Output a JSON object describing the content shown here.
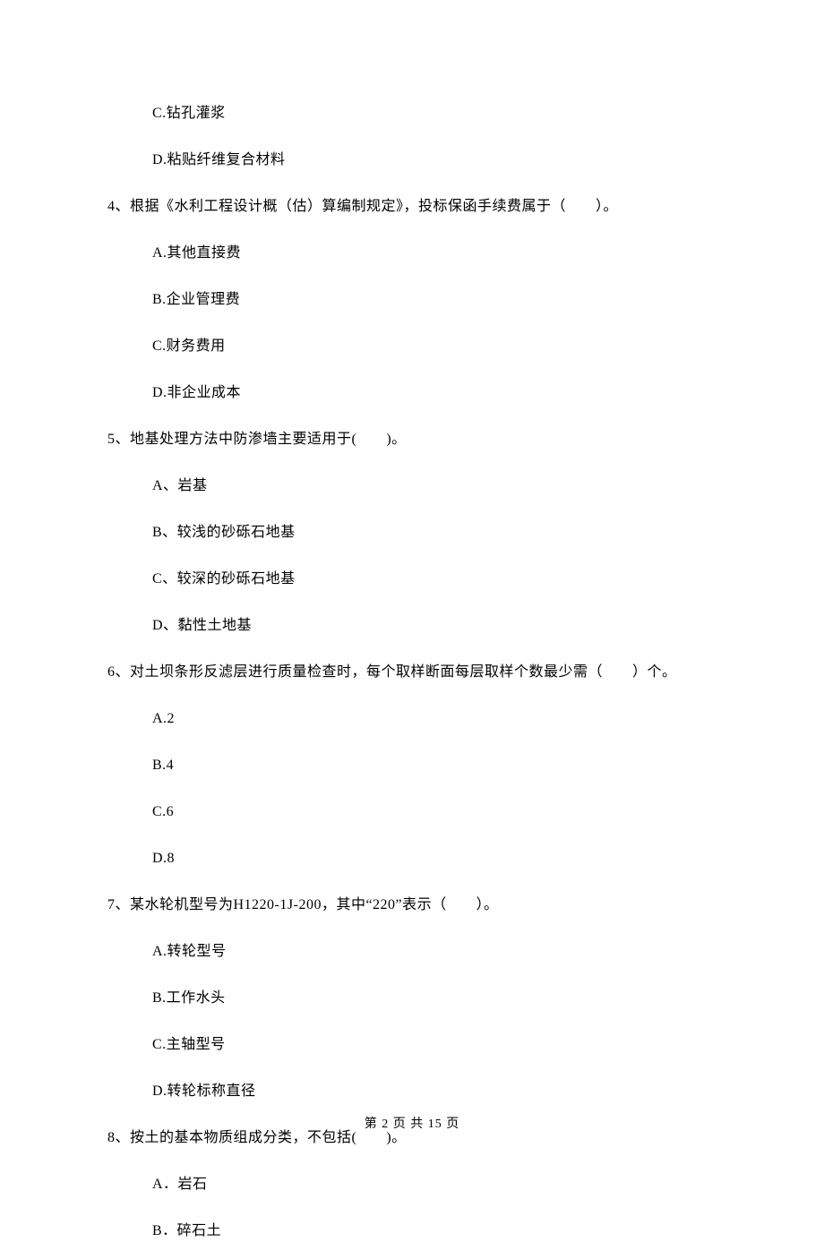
{
  "options_pre": [
    "C.钻孔灌浆",
    "D.粘贴纤维复合材料"
  ],
  "questions": [
    {
      "stem": "4、根据《水利工程设计概（估）算编制规定》，投标保函手续费属于（　　）。",
      "options": [
        "A.其他直接费",
        "B.企业管理费",
        "C.财务费用",
        "D.非企业成本"
      ]
    },
    {
      "stem": "5、地基处理方法中防渗墙主要适用于(　　)。",
      "options": [
        "A、岩基",
        "B、较浅的砂砾石地基",
        "C、较深的砂砾石地基",
        "D、黏性土地基"
      ]
    },
    {
      "stem": "6、对土坝条形反滤层进行质量检查时，每个取样断面每层取样个数最少需（　　）个。",
      "options": [
        "A.2",
        "B.4",
        "C.6",
        "D.8"
      ]
    },
    {
      "stem": "7、某水轮机型号为H1220-1J-200，其中“220”表示（　　）。",
      "options": [
        "A.转轮型号",
        "B.工作水头",
        "C.主轴型号",
        "D.转轮标称直径"
      ]
    },
    {
      "stem": "8、按土的基本物质组成分类，不包括(　　)。",
      "options": [
        "A．岩石",
        "B．碎石土"
      ]
    }
  ],
  "footer": "第 2 页 共 15 页"
}
